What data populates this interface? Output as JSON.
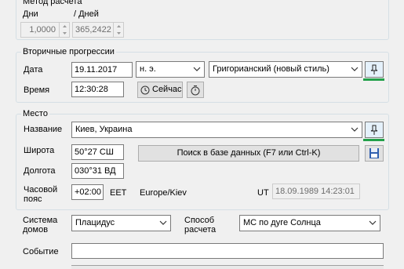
{
  "method": {
    "legend": "Метод расчета",
    "days_label": "Дни",
    "per_days_label": "/ Дней",
    "days_value": "1,0000",
    "per_days_value": "365,2422"
  },
  "progressions": {
    "legend": "Вторичные прогрессии",
    "date_label": "Дата",
    "date_value": "19.11.2017",
    "era_value": "н. э.",
    "calendar_value": "Григорианский (новый стиль)",
    "time_label": "Время",
    "time_value": "12:30:28",
    "now_button": "Сейчас"
  },
  "place": {
    "legend": "Место",
    "name_label": "Название",
    "name_value": "Киев, Украина",
    "lat_label": "Широта",
    "lat_value": "50°27 СШ",
    "search_button": "Поиск в базе данных (F7 или Ctrl-K)",
    "lon_label": "Долгота",
    "lon_value": "030°31 ВД",
    "tz_label": "Часовой пояс",
    "tz_value": "+02:00",
    "tz_abbr": "EET",
    "tz_name": "Europe/Kiev",
    "ut_label": "UT",
    "ut_value": "18.09.1989 14:23:01"
  },
  "bottom": {
    "houses_label": "Система домов",
    "houses_value": "Плацидус",
    "calc_label": "Способ расчета",
    "calc_value": "МС по дуге Солнца",
    "event_label": "Событие",
    "event_value": ""
  },
  "colors": {
    "accent_green": "#22a04a",
    "focus_blue": "#0078d7"
  }
}
